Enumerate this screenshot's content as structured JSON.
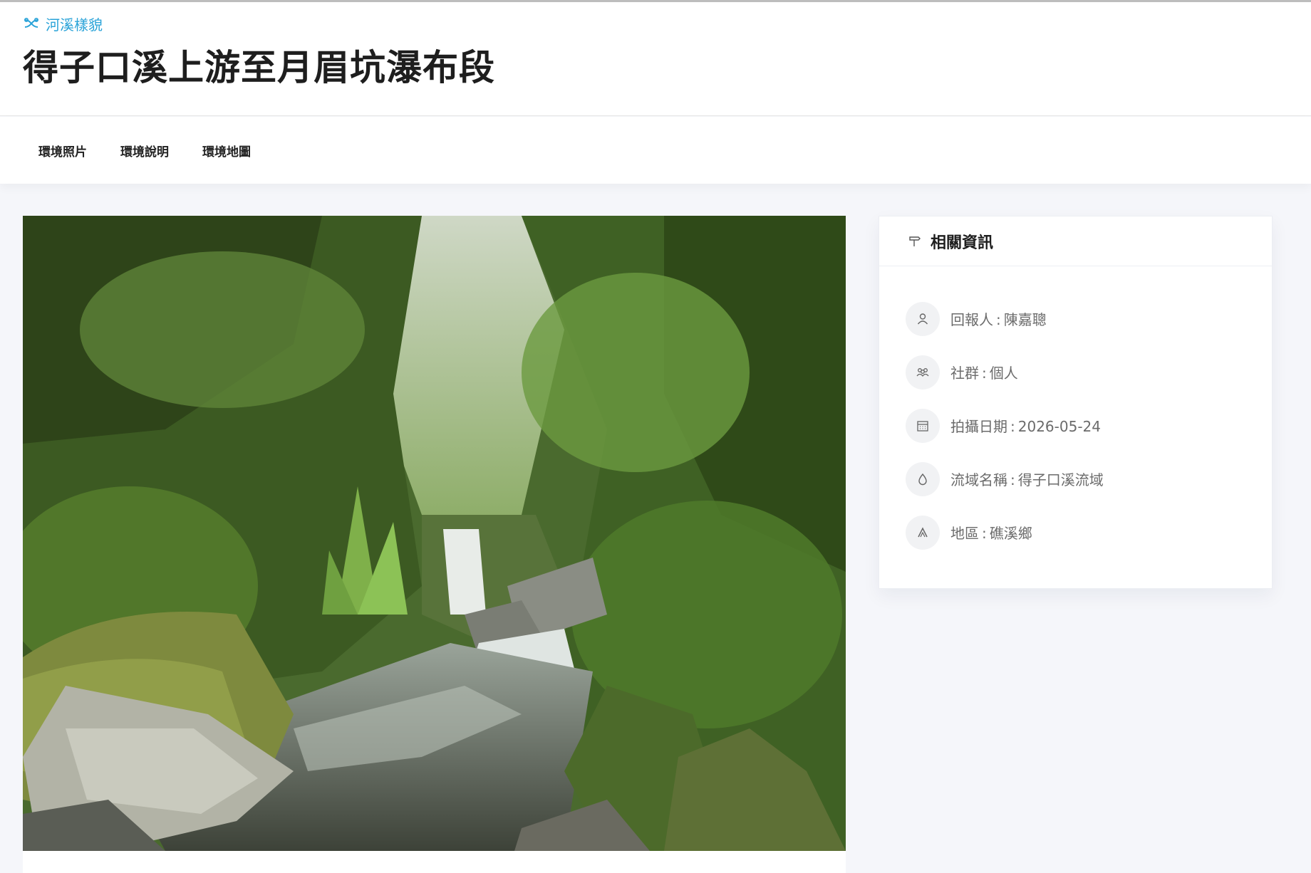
{
  "header": {
    "category": "河溪樣貌",
    "category_icon": "river-fork-icon",
    "title": "得子口溪上游至月眉坑瀑布段"
  },
  "tabs": [
    {
      "label": "環境照片"
    },
    {
      "label": "環境說明"
    },
    {
      "label": "環境地圖"
    }
  ],
  "photo": {
    "subject": "stream-waterfall-forest"
  },
  "info": {
    "title": "相關資訊",
    "title_icon": "signpost-icon",
    "items": [
      {
        "icon": "user-icon",
        "label": "回報人",
        "value": "陳嘉聰"
      },
      {
        "icon": "group-icon",
        "label": "社群",
        "value": "個人"
      },
      {
        "icon": "calendar-icon",
        "label": "拍攝日期",
        "value": "2026-05-24"
      },
      {
        "icon": "water-drop-icon",
        "label": "流域名稱",
        "value": "得子口溪流域"
      },
      {
        "icon": "mountain-icon",
        "label": "地區",
        "value": "礁溪鄉"
      }
    ]
  },
  "colors": {
    "accent": "#2aa3d8",
    "background": "#f5f6fa",
    "icon_bg": "#f1f2f4"
  }
}
